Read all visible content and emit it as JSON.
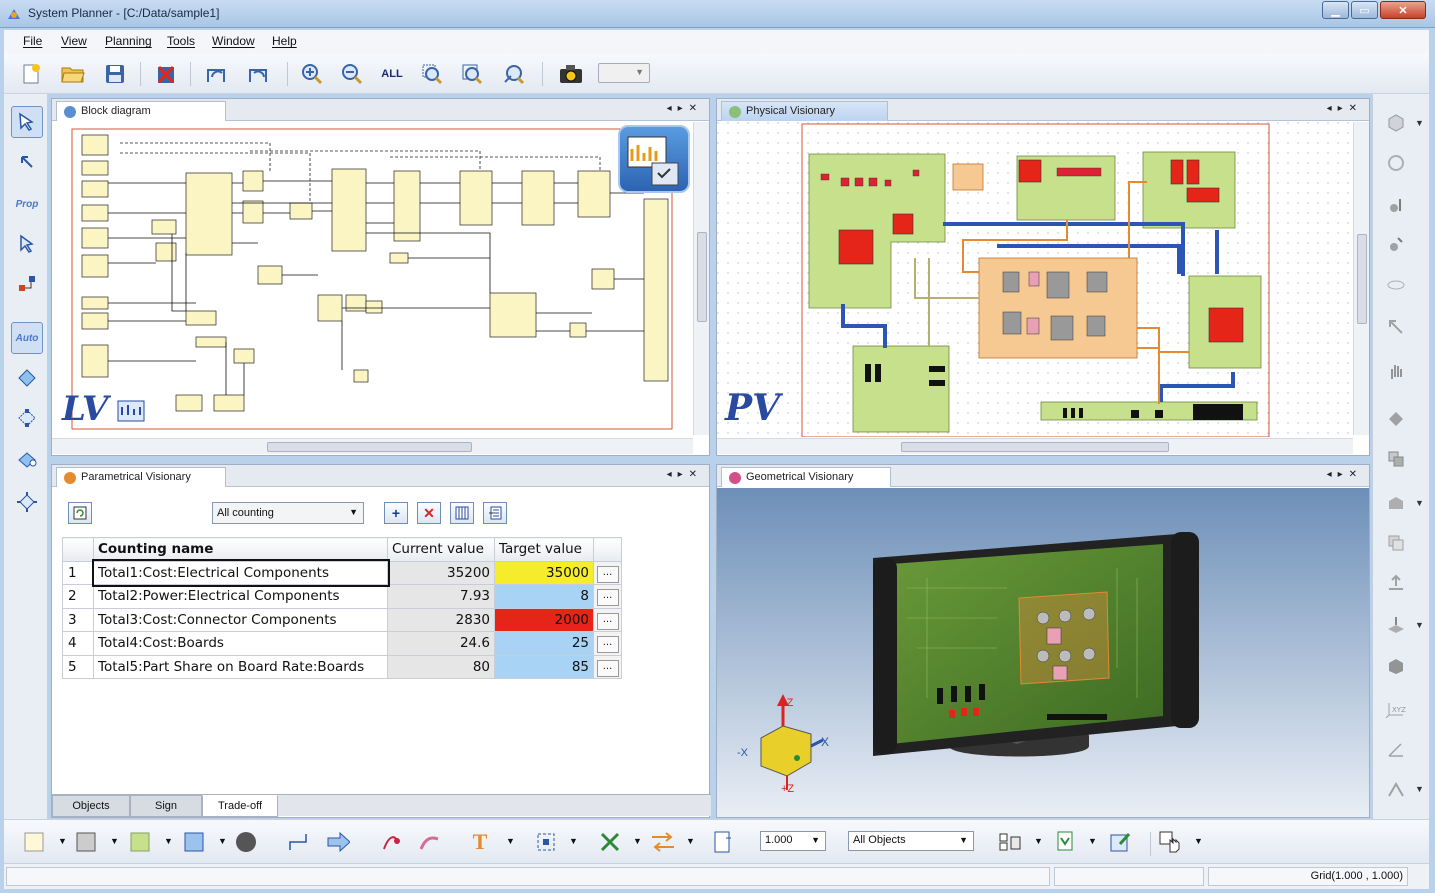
{
  "window": {
    "title": "System Planner - [C:/Data/sample1]",
    "minimize": "▁",
    "maximize": "▭",
    "close": "✕"
  },
  "menu": [
    "File",
    "View",
    "Planning",
    "Tools",
    "Window",
    "Help"
  ],
  "toolbar": {
    "icons": [
      "new-file-icon",
      "open-folder-icon",
      "save-icon",
      "delete-icon",
      "undo-icon",
      "redo-icon",
      "zoom-in-icon",
      "zoom-out-icon",
      "zoom-all-icon",
      "zoom-window-icon",
      "zoom-fit-icon",
      "zoom-previous-icon",
      "camera-icon"
    ],
    "zoom_all_label": "ALL",
    "combo_value": ""
  },
  "left_tools": {
    "labels": [
      "Prop",
      "Auto"
    ]
  },
  "panels": {
    "block": {
      "tab": "Block diagram",
      "overlay_text": "LV"
    },
    "physical": {
      "tab": "Physical Visionary",
      "overlay_text": "PV"
    },
    "param": {
      "tab": "Parametrical Visionary",
      "select_value": "All counting",
      "buttons": [
        "+",
        "✕"
      ],
      "columns": [
        "Counting name",
        "Current value",
        "Target value"
      ],
      "rows": [
        {
          "num": "1",
          "name": "Total1:Cost:Electrical Components",
          "current": "35200",
          "target": "35000",
          "target_color": "#f5ec2c"
        },
        {
          "num": "2",
          "name": "Total2:Power:Electrical Components",
          "current": "7.93",
          "target": "8",
          "target_color": "#a9d3f5"
        },
        {
          "num": "3",
          "name": "Total3:Cost:Connector Components",
          "current": "2830",
          "target": "2000",
          "target_color": "#e52517"
        },
        {
          "num": "4",
          "name": "Total4:Cost:Boards",
          "current": "24.6",
          "target": "25",
          "target_color": "#a9d3f5"
        },
        {
          "num": "5",
          "name": "Total5:Part Share on Board Rate:Boards",
          "current": "80",
          "target": "85",
          "target_color": "#a9d3f5"
        }
      ],
      "ellipsis": "...",
      "bottom_tabs": [
        "Objects",
        "Sign",
        "Trade-off"
      ]
    },
    "geometric": {
      "tab": "Geometrical Visionary",
      "axis_labels": {
        "neg_z": "-Z",
        "pos_z": "+Z",
        "x": "X",
        "neg_x": "-X"
      }
    }
  },
  "bottom_toolbar": {
    "scale_value": "1.000",
    "objects_value": "All Objects",
    "text_tool": "T"
  },
  "status": {
    "grid": "Grid(1.000 , 1.000)"
  },
  "colors": {
    "board_green": "#c7e08c",
    "board_orange": "#f7c992",
    "trace_blue": "#2c55b5",
    "trace_orange": "#e48a30",
    "highlight_yellow": "#f5ec2c",
    "highlight_red": "#e52517",
    "highlight_blue": "#a9d3f5"
  }
}
